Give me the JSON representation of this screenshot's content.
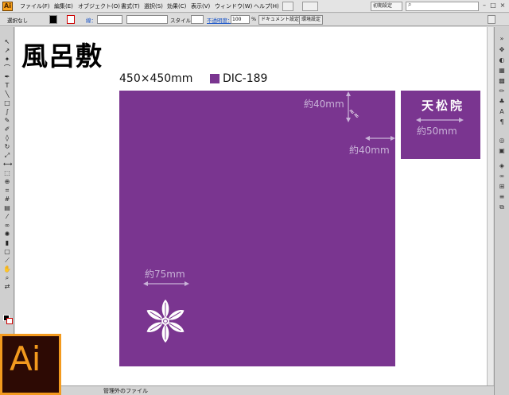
{
  "app": {
    "logo": "Ai",
    "title_icon": "ai-app-icon"
  },
  "menubar": {
    "items": [
      "ファイル(F)",
      "編集(E)",
      "オブジェクト(O)",
      "書式(T)",
      "選択(S)",
      "効果(C)",
      "表示(V)",
      "ウィンドウ(W)",
      "ヘルプ(H)"
    ],
    "workspace": "初期設定",
    "search_placeholder": ""
  },
  "controlbar": {
    "selection_state": "選択なし",
    "stroke_label": "線：",
    "style_label": "スタイル：",
    "opacity_label": "不透明度：",
    "opacity_value": "100",
    "opacity_unit": "%",
    "doc_setup_button": "ドキュメント設定",
    "prefs_button": "環境設定"
  },
  "document": {
    "title": "風呂敷",
    "size": "450×450mm",
    "color_name": "DIC-189",
    "color_hex": "#7a3590",
    "dim_top_right_vertical": "約40mm",
    "dim_top_right_horizontal": "約40mm",
    "dim_emblem": "約75mm",
    "dim_side": "約50mm",
    "temple_name": "天松院"
  },
  "statusbar": {
    "zoom": "",
    "status": "管理外のファイル"
  }
}
